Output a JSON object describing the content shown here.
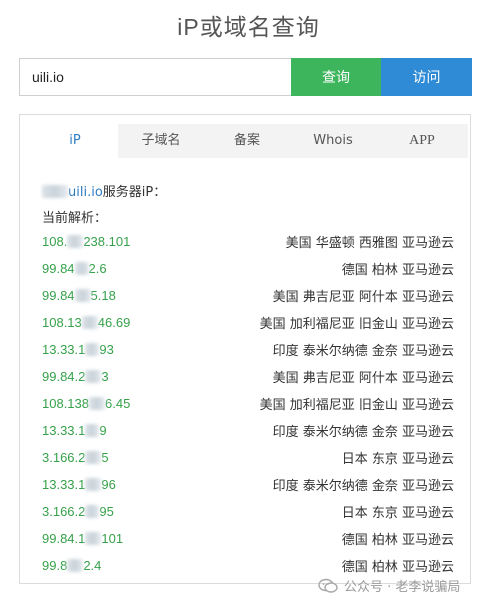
{
  "title": "iP或域名查询",
  "search": {
    "value": "uili.io",
    "query_label": "查询",
    "visit_label": "访问"
  },
  "tabs": [
    {
      "label": "iP",
      "active": true
    },
    {
      "label": "子域名",
      "active": false
    },
    {
      "label": "备案",
      "active": false
    },
    {
      "label": "Whois",
      "active": false
    },
    {
      "label": "APP",
      "active": false
    }
  ],
  "result": {
    "domain": "uili.io",
    "domain_suffix": "服务器iP：",
    "current_label": "当前解析：",
    "rows": [
      {
        "ip_a": "108.",
        "ip_b": "238.101",
        "location": "美国 华盛顿 西雅图 亚马逊云"
      },
      {
        "ip_a": "99.84",
        "ip_b": "2.6",
        "location": "德国 柏林 亚马逊云"
      },
      {
        "ip_a": "99.84",
        "ip_b": "5.18",
        "location": "美国 弗吉尼亚 阿什本 亚马逊云"
      },
      {
        "ip_a": "108.13",
        "ip_b": "46.69",
        "location": "美国 加利福尼亚 旧金山 亚马逊云"
      },
      {
        "ip_a": "13.33.1",
        "ip_b": "93",
        "location": "印度 泰米尔纳德 金奈 亚马逊云"
      },
      {
        "ip_a": "99.84.2",
        "ip_b": "3",
        "location": "美国 弗吉尼亚 阿什本 亚马逊云"
      },
      {
        "ip_a": "108.138",
        "ip_b": "6.45",
        "location": "美国 加利福尼亚 旧金山 亚马逊云"
      },
      {
        "ip_a": "13.33.1",
        "ip_b": "9",
        "location": "印度 泰米尔纳德 金奈 亚马逊云"
      },
      {
        "ip_a": "3.166.2",
        "ip_b": "5",
        "location": "日本 东京 亚马逊云"
      },
      {
        "ip_a": "13.33.1",
        "ip_b": "96",
        "location": "印度 泰米尔纳德 金奈 亚马逊云"
      },
      {
        "ip_a": "3.166.2",
        "ip_b": "95",
        "location": "日本 东京 亚马逊云"
      },
      {
        "ip_a": "99.84.1",
        "ip_b": "101",
        "location": "德国 柏林 亚马逊云"
      },
      {
        "ip_a": "99.8",
        "ip_b": "2.4",
        "location": "德国 柏林 亚马逊云"
      }
    ]
  },
  "watermark": {
    "text": "公众号 · 老李说骗局",
    "icon": "wechat-icon"
  },
  "colors": {
    "query_button": "#3cb55c",
    "visit_button": "#2f8bd5",
    "ip_text": "#36a14a",
    "link": "#2e7cc2"
  }
}
